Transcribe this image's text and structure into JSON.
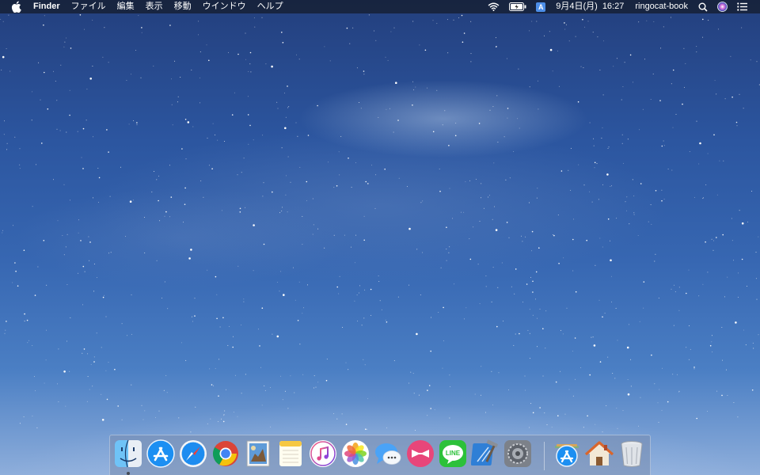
{
  "menubar": {
    "app_name": "Finder",
    "menus": [
      "ファイル",
      "編集",
      "表示",
      "移動",
      "ウインドウ",
      "ヘルプ"
    ],
    "input_source": "A",
    "date": "9月4日(月)",
    "time": "16:27",
    "user": "ringocat-book"
  },
  "dock": {
    "apps": [
      {
        "name": "Finder",
        "icon": "finder-icon"
      },
      {
        "name": "App Store",
        "icon": "app-store-icon"
      },
      {
        "name": "Safari",
        "icon": "safari-icon"
      },
      {
        "name": "Google Chrome",
        "icon": "chrome-icon"
      },
      {
        "name": "Preview",
        "icon": "preview-icon"
      },
      {
        "name": "Notes",
        "icon": "notes-icon"
      },
      {
        "name": "iTunes",
        "icon": "itunes-icon"
      },
      {
        "name": "Photos",
        "icon": "photos-icon"
      },
      {
        "name": "Messages",
        "icon": "messages-icon"
      },
      {
        "name": "Skitch",
        "icon": "skitch-icon"
      },
      {
        "name": "LINE",
        "icon": "line-icon",
        "label": "LINE"
      },
      {
        "name": "Xcode",
        "icon": "xcode-icon"
      },
      {
        "name": "System Preferences",
        "icon": "gear-icon"
      }
    ],
    "stacks": [
      {
        "name": "Applications",
        "icon": "applications-folder-icon"
      },
      {
        "name": "Home",
        "icon": "home-icon"
      },
      {
        "name": "Trash",
        "icon": "trash-icon"
      }
    ],
    "colors": {
      "line": "#2cc13a",
      "skitch": "#e8467a",
      "app_store": "#1c8ff2"
    }
  }
}
